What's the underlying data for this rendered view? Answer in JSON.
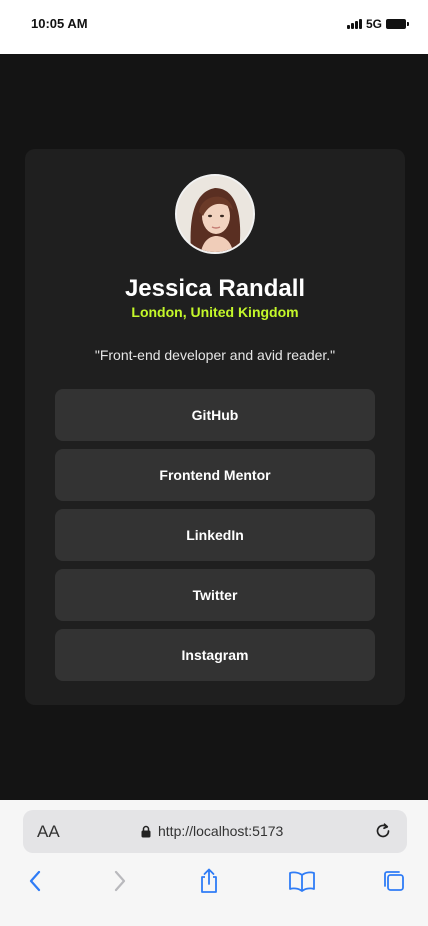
{
  "status_bar": {
    "time": "10:05 AM",
    "network": "5G"
  },
  "profile": {
    "name": "Jessica Randall",
    "location": "London, United Kingdom",
    "bio": "\"Front-end developer and avid reader.\""
  },
  "links": [
    {
      "label": "GitHub"
    },
    {
      "label": "Frontend Mentor"
    },
    {
      "label": "LinkedIn"
    },
    {
      "label": "Twitter"
    },
    {
      "label": "Instagram"
    }
  ],
  "browser": {
    "text_size_label": "AA",
    "url": "http://localhost:5173"
  },
  "colors": {
    "page_background": "#141414",
    "card_background": "#1f1f1f",
    "button_background": "#333333",
    "accent": "#c4f82a",
    "browser_blue": "#2f7cf6"
  }
}
